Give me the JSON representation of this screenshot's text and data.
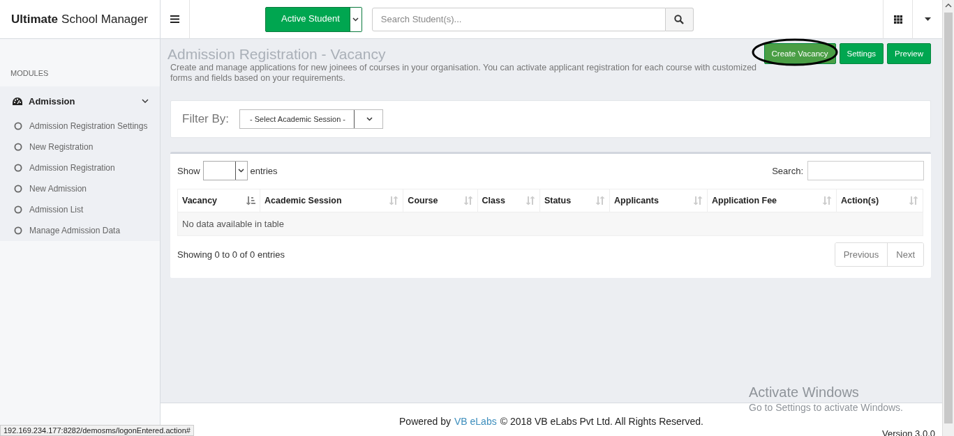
{
  "brand": {
    "bold": "Ultimate",
    "rest": "School Manager"
  },
  "topbar": {
    "student_filter": "Active Student",
    "search": {
      "placeholder": "Search Student(s)..."
    }
  },
  "sidebar": {
    "heading": "MODULES",
    "group": {
      "label": "Admission",
      "expanded": true,
      "items": [
        {
          "label": "Admission Registration Settings"
        },
        {
          "label": "New Registration"
        },
        {
          "label": "Admission Registration"
        },
        {
          "label": "New Admission"
        },
        {
          "label": "Admission List"
        },
        {
          "label": "Manage Admission Data"
        }
      ]
    }
  },
  "page": {
    "title": "Admission Registration - Vacancy",
    "description": "Create and manage applications for new joinees of courses in your organisation. You can activate applicant registration for each course with customized forms and fields based on your requirements.",
    "buttons": [
      {
        "label": "Create Vacancy",
        "highlighted": true
      },
      {
        "label": "Settings",
        "highlighted": false
      },
      {
        "label": "Preview",
        "highlighted": false
      }
    ]
  },
  "filter": {
    "label": "Filter By:",
    "select": "- Select Academic Session -"
  },
  "table": {
    "show_label": "Show",
    "entries_label": "entries",
    "search_label": "Search:",
    "columns": [
      {
        "label": "Vacancy",
        "sorted": true
      },
      {
        "label": "Academic Session",
        "sorted": false
      },
      {
        "label": "Course",
        "sorted": false
      },
      {
        "label": "Class",
        "sorted": false
      },
      {
        "label": "Status",
        "sorted": false
      },
      {
        "label": "Applicants",
        "sorted": false
      },
      {
        "label": "Application Fee",
        "sorted": false
      },
      {
        "label": "Action(s)",
        "sorted": false
      }
    ],
    "empty": "No data available in table",
    "info": "Showing 0 to 0 of 0 entries",
    "pagination": [
      "Previous",
      "Next"
    ]
  },
  "footer": {
    "prefix": "Powered by",
    "link": "VB eLabs",
    "suffix": "© 2018 VB eLabs Pvt Ltd. All Rights Reserved.",
    "version": "Version 3.0.0"
  },
  "windows_notice": {
    "title": "Activate Windows",
    "subtitle": "Go to Settings to activate Windows."
  },
  "status_url": "192.169.234.177:8282/demosms/logonEntered.action#"
}
